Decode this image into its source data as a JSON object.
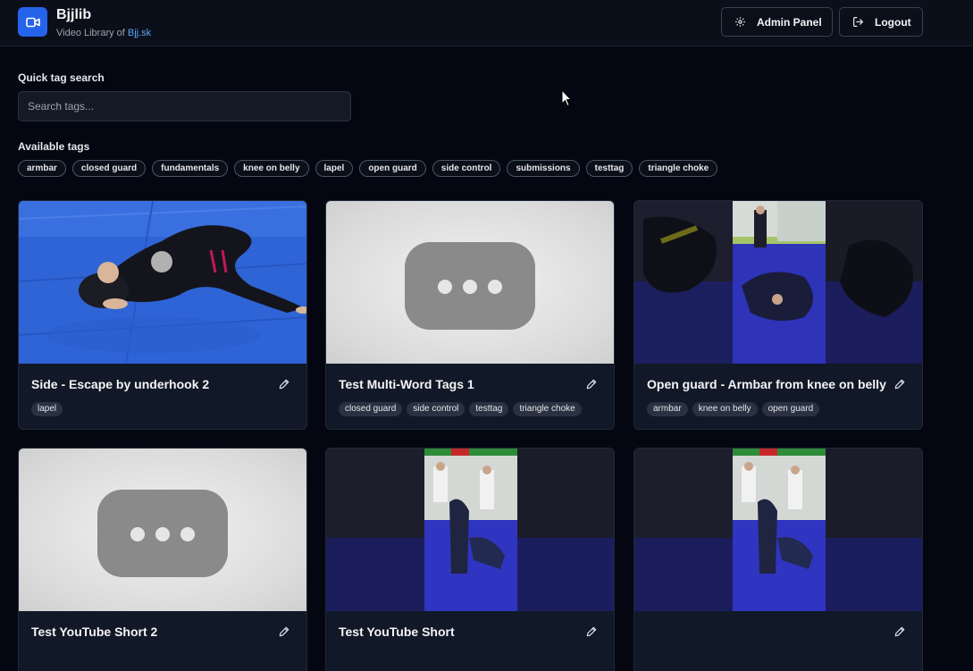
{
  "header": {
    "app_name": "Bjjlib",
    "subtitle_prefix": "Video Library of ",
    "subtitle_link": "Bjj.sk",
    "admin_label": "Admin Panel",
    "logout_label": "Logout"
  },
  "search": {
    "label": "Quick tag search",
    "placeholder": "Search tags..."
  },
  "available": {
    "label": "Available tags",
    "tags": [
      "armbar",
      "closed guard",
      "fundamentals",
      "knee on belly",
      "lapel",
      "open guard",
      "side control",
      "submissions",
      "testtag",
      "triangle choke"
    ]
  },
  "videos": [
    {
      "title": "Side - Escape by underhook 2",
      "tags": [
        "lapel"
      ],
      "thumb": "mat-photo"
    },
    {
      "title": "Test Multi-Word Tags 1",
      "tags": [
        "closed guard",
        "side control",
        "testtag",
        "triangle choke"
      ],
      "thumb": "placeholder"
    },
    {
      "title": "Open guard - Armbar from knee on belly",
      "tags": [
        "armbar",
        "knee on belly",
        "open guard"
      ],
      "thumb": "vertical-video"
    },
    {
      "title": "Test YouTube Short 2",
      "tags": [],
      "thumb": "placeholder"
    },
    {
      "title": "Test YouTube Short",
      "tags": [],
      "thumb": "vertical-video"
    },
    {
      "title": "",
      "tags": [],
      "thumb": "vertical-video"
    }
  ],
  "colors": {
    "accent": "#2563eb",
    "background": "#040711",
    "card": "#111827",
    "link": "#60a5fa"
  }
}
